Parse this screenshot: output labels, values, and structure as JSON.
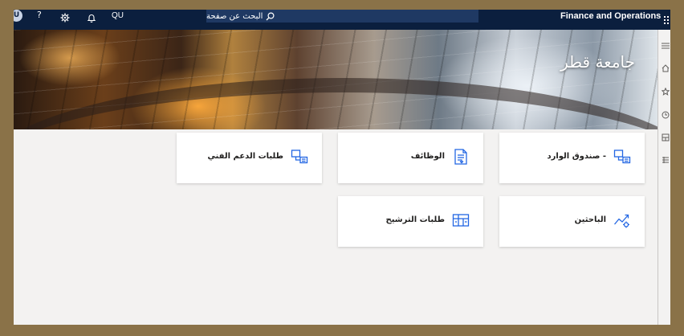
{
  "topbar": {
    "avatar_initial": "U",
    "help_glyph": "?",
    "company_code": "QU",
    "search_placeholder": "البحث عن صفحة",
    "app_title": "Finance and Operations",
    "icons": [
      "help-icon",
      "gear-icon",
      "bell-icon",
      "search-icon",
      "app-launcher-icon"
    ]
  },
  "banner": {
    "title": "جامعة قطر"
  },
  "tiles": [
    {
      "label": "- صندوق الوارد",
      "icon": "inbox-workflow-icon"
    },
    {
      "label": "الوظائف",
      "icon": "jobs-document-icon"
    },
    {
      "label": "طلبات الدعم الفني",
      "icon": "support-requests-icon"
    },
    {
      "label": "الباحثين",
      "icon": "researchers-trend-icon"
    },
    {
      "label": "طلبات الترشيح",
      "icon": "nomination-requests-icon"
    }
  ],
  "right_nav": {
    "icons": [
      "collapse-menu-icon",
      "home-icon",
      "favorites-icon",
      "recent-icon",
      "workspaces-icon",
      "modules-icon"
    ]
  },
  "colors": {
    "topbar": "#0b1f3e",
    "search_box": "#1f3963",
    "tile_icon": "#2266e3",
    "page_background": "#f3f2f1",
    "outer_frame": "#8a7248"
  }
}
